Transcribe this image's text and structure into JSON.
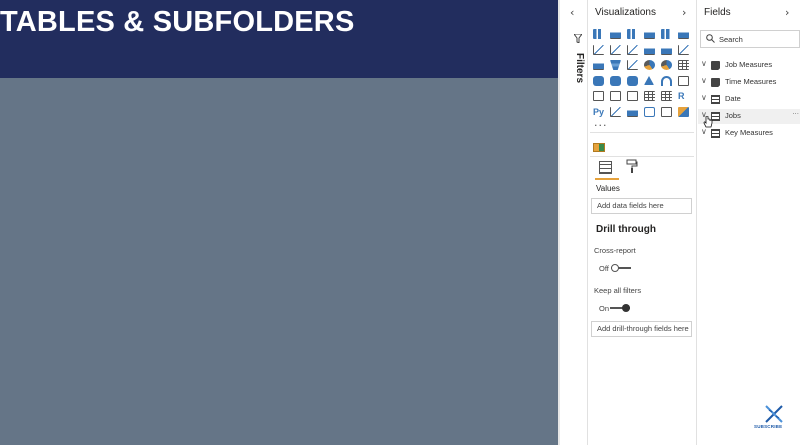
{
  "report": {
    "banner_title": "TABLES & SUBFOLDERS",
    "banner_color": "#222d5e",
    "canvas_color": "#657587"
  },
  "filters": {
    "label": "Filters",
    "collapse_icon": "chevron-left-icon"
  },
  "visualizations": {
    "title": "Visualizations",
    "more_label": "···",
    "fields_tab_icon": "fields-icon",
    "format_tab_icon": "paint-roller-icon",
    "values_label": "Values",
    "values_placeholder": "Add data fields here",
    "drill_through": {
      "title": "Drill through",
      "cross_report_label": "Cross-report",
      "cross_report_state": "Off",
      "keep_filters_label": "Keep all filters",
      "keep_filters_state": "On",
      "placeholder": "Add drill-through fields here"
    },
    "accent_color": "#e6a23c"
  },
  "fields": {
    "title": "Fields",
    "search_placeholder": "Search",
    "items": [
      {
        "label": "Job Measures",
        "type": "measure-table",
        "icon": "calculator-icon"
      },
      {
        "label": "Time Measures",
        "type": "measure-table",
        "icon": "calculator-icon"
      },
      {
        "label": "Date",
        "type": "table",
        "icon": "table-icon"
      },
      {
        "label": "Jobs",
        "type": "table",
        "icon": "table-icon",
        "more": "···"
      },
      {
        "label": "Key Measures",
        "type": "table",
        "icon": "table-icon"
      }
    ]
  },
  "watermark": {
    "text": "SUBSCRIBE",
    "icon": "dna-icon"
  }
}
